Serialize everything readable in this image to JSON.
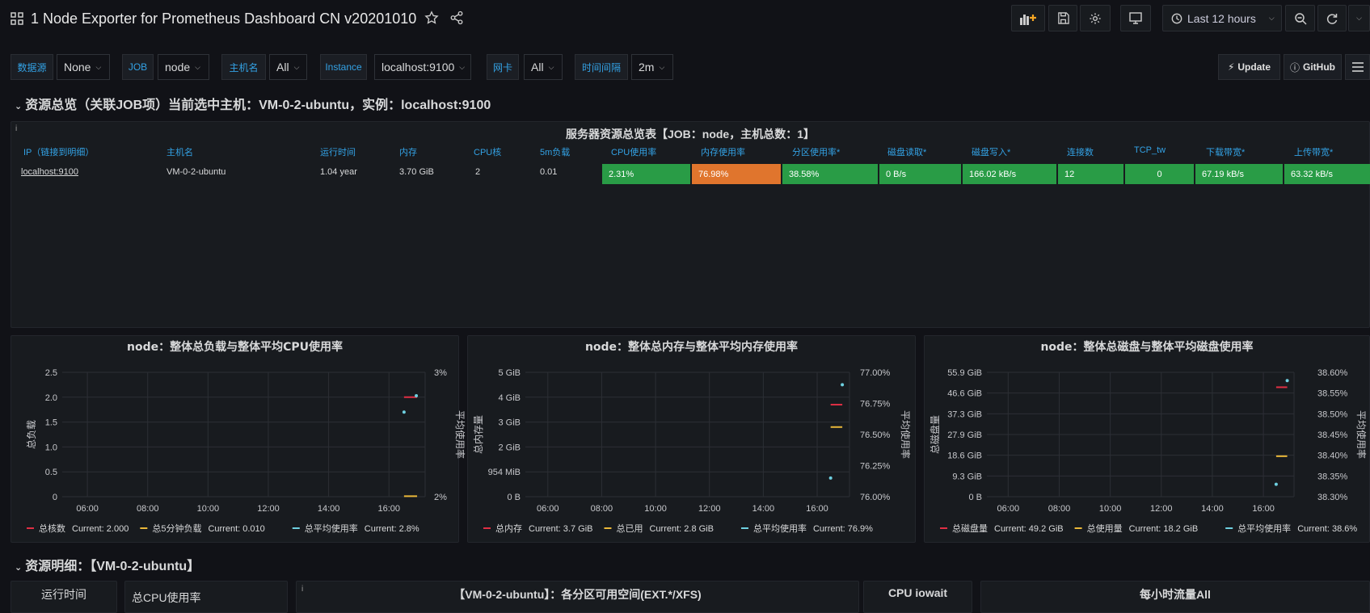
{
  "header": {
    "title": "1 Node Exporter for Prometheus Dashboard CN v20201010",
    "time_range": "Last 12 hours"
  },
  "variables": [
    {
      "label": "数据源",
      "value": "None"
    },
    {
      "label": "JOB",
      "value": "node"
    },
    {
      "label": "主机名",
      "value": "All"
    },
    {
      "label": "Instance",
      "value": "localhost:9100"
    },
    {
      "label": "网卡",
      "value": "All"
    },
    {
      "label": "时间间隔",
      "value": "2m"
    }
  ],
  "links": {
    "update": "Update",
    "github": "GitHub"
  },
  "row1": {
    "title": "资源总览（关联JOB项）当前选中主机：VM-0-2-ubuntu，实例：localhost:9100"
  },
  "table": {
    "title": "服务器资源总览表【JOB：node，主机总数：1】",
    "headers": [
      "IP（链接到明细）",
      "主机名",
      "运行时间",
      "内存",
      "CPU核",
      "5m负载",
      "CPU使用率",
      "内存使用率",
      "分区使用率*",
      "磁盘读取*",
      "磁盘写入*",
      "连接数",
      "TCP_tw",
      "下载带宽*",
      "上传带宽*"
    ],
    "row": [
      "localhost:9100",
      "VM-0-2-ubuntu",
      "1.04 year",
      "3.70 GiB",
      "2",
      "0.01",
      "2.31%",
      "76.98%",
      "38.58%",
      "0 B/s",
      "166.02 kB/s",
      "12",
      "0",
      "67.19 kB/s",
      "63.32 kB/s"
    ],
    "cell_colors": [
      "#299c46",
      "#e0752d",
      "#299c46",
      "#299c46",
      "#299c46",
      "#299c46",
      "#299c46",
      "#299c46",
      "#299c46"
    ]
  },
  "chart_data": [
    {
      "type": "line",
      "title": "node：整体总负载与整体平均CPU使用率",
      "ylabel": "总负载",
      "y2label": "平均使用率",
      "ylim": [
        0,
        2.5
      ],
      "y2lim": [
        "2%",
        "3%"
      ],
      "yticks": [
        "0",
        "0.5",
        "1.0",
        "1.5",
        "2.0",
        "2.5"
      ],
      "y2ticks": [
        "2%",
        "3%"
      ],
      "xticks": [
        "06:00",
        "08:00",
        "10:00",
        "12:00",
        "14:00",
        "16:00"
      ],
      "grid": true,
      "legend_position": "bottom",
      "series": [
        {
          "name": "总核数",
          "current": "Current: 2.000",
          "color": "#e02f44",
          "points": [
            [
              "16:30",
              2.0
            ],
            [
              "16:56",
              2.0
            ]
          ]
        },
        {
          "name": "总5分钟负载",
          "current": "Current: 0.010",
          "color": "#eab839",
          "points": [
            [
              "16:30",
              0.01
            ],
            [
              "16:56",
              0.01
            ]
          ]
        },
        {
          "name": "总平均使用率",
          "current": "Current: 2.8%",
          "color": "#6ed0e0",
          "points": [
            [
              "16:30",
              1.7
            ],
            [
              "16:56",
              2.03
            ]
          ]
        }
      ]
    },
    {
      "type": "line",
      "title": "node：整体总内存与整体平均内存使用率",
      "ylabel": "总内存量",
      "y2label": "平均使用率",
      "yticks": [
        "0 B",
        "954 MiB",
        "2 GiB",
        "3 GiB",
        "4 GiB",
        "5 GiB"
      ],
      "y2ticks": [
        "76.00%",
        "76.25%",
        "76.50%",
        "76.75%",
        "77.00%"
      ],
      "xticks": [
        "06:00",
        "08:00",
        "10:00",
        "12:00",
        "14:00",
        "16:00"
      ],
      "grid": true,
      "legend_position": "bottom",
      "series": [
        {
          "name": "总内存",
          "current": "Current: 3.7 GiB",
          "color": "#e02f44",
          "points": [
            [
              "16:30",
              "3.7 GiB"
            ],
            [
              "16:56",
              "3.7 GiB"
            ]
          ]
        },
        {
          "name": "总已用",
          "current": "Current: 2.8 GiB",
          "color": "#eab839",
          "points": [
            [
              "16:30",
              "2.8 GiB"
            ],
            [
              "16:56",
              "2.8 GiB"
            ]
          ]
        },
        {
          "name": "总平均使用率",
          "current": "Current: 76.9%",
          "color": "#6ed0e0",
          "points": [
            [
              "16:30",
              "76.15%"
            ],
            [
              "16:56",
              "76.90%"
            ]
          ]
        }
      ]
    },
    {
      "type": "line",
      "title": "node：整体总磁盘与整体平均磁盘使用率",
      "ylabel": "总磁盘量",
      "y2label": "平均使用率",
      "yticks": [
        "0 B",
        "9.3 GiB",
        "18.6 GiB",
        "27.9 GiB",
        "37.3 GiB",
        "46.6 GiB",
        "55.9 GiB"
      ],
      "y2ticks": [
        "38.30%",
        "38.35%",
        "38.40%",
        "38.45%",
        "38.50%",
        "38.55%",
        "38.60%"
      ],
      "xticks": [
        "06:00",
        "08:00",
        "10:00",
        "12:00",
        "14:00",
        "16:00"
      ],
      "grid": true,
      "legend_position": "bottom",
      "series": [
        {
          "name": "总磁盘量",
          "current": "Current: 49.2 GiB",
          "color": "#e02f44",
          "points": [
            [
              "16:30",
              "49.2 GiB"
            ],
            [
              "16:56",
              "49.2 GiB"
            ]
          ]
        },
        {
          "name": "总使用量",
          "current": "Current: 18.2 GiB",
          "color": "#eab839",
          "points": [
            [
              "16:30",
              "18.2 GiB"
            ],
            [
              "16:56",
              "18.2 GiB"
            ]
          ]
        },
        {
          "name": "总平均使用率",
          "current": "Current: 38.6%",
          "color": "#6ed0e0",
          "points": [
            [
              "16:30",
              "38.33%"
            ],
            [
              "16:56",
              "38.58%"
            ]
          ]
        }
      ]
    }
  ],
  "row2": {
    "title": "资源明细：【VM-0-2-ubuntu】"
  },
  "bottom_panels": [
    "运行时间",
    "总CPU使用率",
    "【VM-0-2-ubuntu】：各分区可用空间(EXT.*/XFS)",
    "CPU iowait",
    "每小时流量All"
  ]
}
